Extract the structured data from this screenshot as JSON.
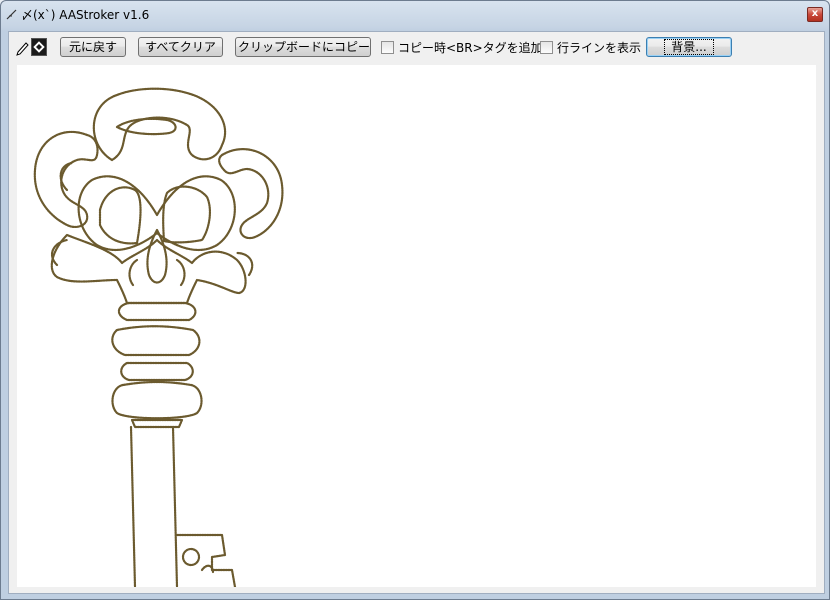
{
  "window": {
    "title": "〆(x`) AAStroker v1.6",
    "close_glyph": "x"
  },
  "toolbar": {
    "tool_mode": "eraser",
    "undo_label": "元に戻す",
    "clear_all_label": "すべてクリア",
    "copy_label": "クリップボードにコピー",
    "add_br_label": "コピー時<BR>タグを追加",
    "add_br_checked": false,
    "show_lines_label": "行ラインを表示",
    "show_lines_checked": false,
    "background_label": "背景..."
  },
  "canvas": {
    "drawing": "key-outline",
    "stroke_color": "#6b5a2e"
  }
}
